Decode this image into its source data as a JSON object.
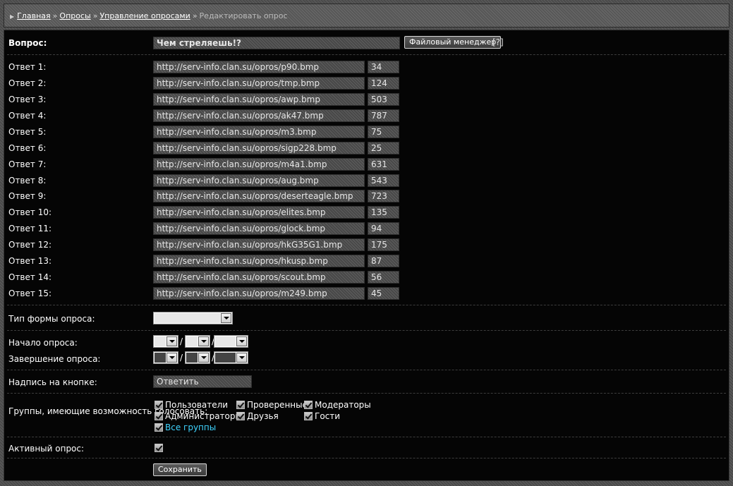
{
  "breadcrumb": {
    "home": "Главная",
    "polls": "Опросы",
    "manage": "Управление опросами",
    "current": "Редактировать опрос",
    "separator": "»"
  },
  "question": {
    "label": "Вопрос:",
    "value": "Чем стреляешь!?",
    "file_manager": "Файловый менеджер",
    "help": "[?]"
  },
  "answers": [
    {
      "label": "Ответ 1:",
      "url": "http://serv-info.clan.su/opros/p90.bmp",
      "votes": "34"
    },
    {
      "label": "Ответ 2:",
      "url": "http://serv-info.clan.su/opros/tmp.bmp",
      "votes": "124"
    },
    {
      "label": "Ответ 3:",
      "url": "http://serv-info.clan.su/opros/awp.bmp",
      "votes": "503"
    },
    {
      "label": "Ответ 4:",
      "url": "http://serv-info.clan.su/opros/ak47.bmp",
      "votes": "787"
    },
    {
      "label": "Ответ 5:",
      "url": "http://serv-info.clan.su/opros/m3.bmp",
      "votes": "75"
    },
    {
      "label": "Ответ 6:",
      "url": "http://serv-info.clan.su/opros/sigp228.bmp",
      "votes": "25"
    },
    {
      "label": "Ответ 7:",
      "url": "http://serv-info.clan.su/opros/m4a1.bmp",
      "votes": "631"
    },
    {
      "label": "Ответ 8:",
      "url": "http://serv-info.clan.su/opros/aug.bmp",
      "votes": "543"
    },
    {
      "label": "Ответ 9:",
      "url": "http://serv-info.clan.su/opros/deserteagle.bmp",
      "votes": "723"
    },
    {
      "label": "Ответ 10:",
      "url": "http://serv-info.clan.su/opros/elites.bmp",
      "votes": "135"
    },
    {
      "label": "Ответ 11:",
      "url": "http://serv-info.clan.su/opros/glock.bmp",
      "votes": "94"
    },
    {
      "label": "Ответ 12:",
      "url": "http://serv-info.clan.su/opros/hkG35G1.bmp",
      "votes": "175"
    },
    {
      "label": "Ответ 13:",
      "url": "http://serv-info.clan.su/opros/hkusp.bmp",
      "votes": "87"
    },
    {
      "label": "Ответ 14:",
      "url": "http://serv-info.clan.su/opros/scout.bmp",
      "votes": "56"
    },
    {
      "label": "Ответ 15:",
      "url": "http://serv-info.clan.su/opros/m249.bmp",
      "votes": "45"
    }
  ],
  "form_type": {
    "label": "Тип формы опроса:"
  },
  "dates": {
    "start_label": "Начало опроса:",
    "end_label": "Завершение опроса:",
    "separator": "/"
  },
  "button_caption": {
    "label": "Надпись на кнопке:",
    "value": "Ответить"
  },
  "groups": {
    "label": "Группы, имеющие возможность голосовать:",
    "items": [
      {
        "name": "Пользователи",
        "checked": true
      },
      {
        "name": "Проверенные",
        "checked": true
      },
      {
        "name": "Модераторы",
        "checked": true
      },
      {
        "name": "Администраторы",
        "checked": true
      },
      {
        "name": "Друзья",
        "checked": true
      },
      {
        "name": "Гости",
        "checked": true
      }
    ],
    "all": {
      "name": "Все группы",
      "checked": true
    }
  },
  "active": {
    "label": "Активный опрос:",
    "checked": true
  },
  "save_button": "Сохранить"
}
